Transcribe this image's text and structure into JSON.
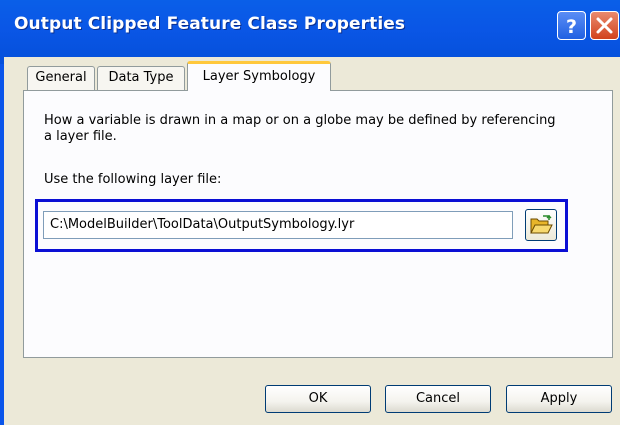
{
  "window": {
    "title": "Output Clipped Feature Class Properties"
  },
  "titlebar_buttons": {
    "help": "?",
    "close": "✕"
  },
  "tabs": [
    {
      "label": "General",
      "active": false
    },
    {
      "label": "Data Type",
      "active": false
    },
    {
      "label": "Layer Symbology",
      "active": true
    }
  ],
  "panel": {
    "description": "How a variable is drawn in a map or on a globe may be defined by referencing a layer file.",
    "layer_file_label": "Use the following layer file:",
    "layer_file_path": "C:\\ModelBuilder\\ToolData\\OutputSymbology.lyr"
  },
  "icons": {
    "browse": "open-folder-icon"
  },
  "buttons": {
    "ok": "OK",
    "cancel": "Cancel",
    "apply": "Apply"
  },
  "colors": {
    "titlebar": "#0a55ea",
    "dialog_bg": "#ece9d8",
    "highlight": "#0b0fd4",
    "active_tab_accent": "#ffc83c"
  }
}
